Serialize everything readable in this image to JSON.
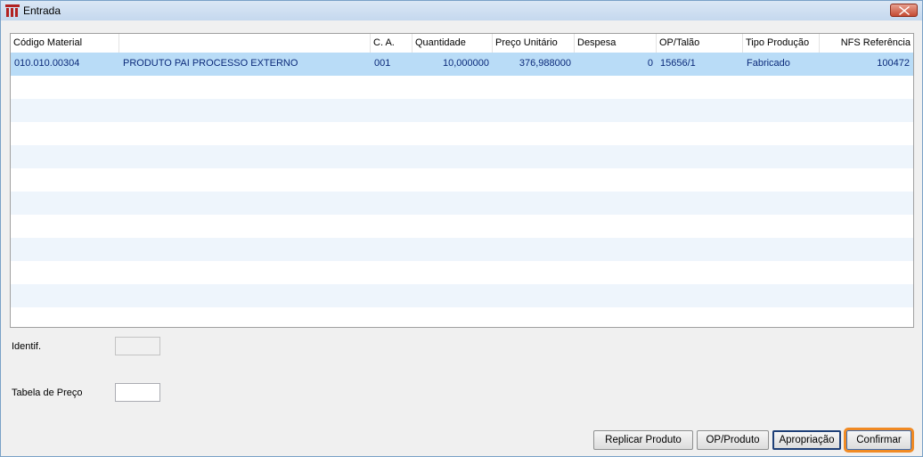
{
  "window": {
    "title": "Entrada"
  },
  "colors": {
    "selected_row": "#b9dcf7",
    "alt_row": "#eef5fc",
    "focus_outline": "#f08a24"
  },
  "grid": {
    "columns": [
      "Código Material",
      "",
      "C. A.",
      "Quantidade",
      "Preço Unitário",
      "Despesa",
      "OP/Talão",
      "Tipo Produção",
      "NFS Referência"
    ],
    "rows": [
      [
        "010.010.00304",
        "PRODUTO PAI PROCESSO EXTERNO",
        "001",
        "10,000000",
        "376,988000",
        "0",
        "15656/1",
        "Fabricado",
        "100472"
      ]
    ]
  },
  "form": {
    "identif_label": "Identif.",
    "identif_value": "",
    "tabela_label": "Tabela de Preço",
    "tabela_value": ""
  },
  "buttons": {
    "replicar": "Replicar Produto",
    "op_produto": "OP/Produto",
    "apropriacao": "Apropriação",
    "confirmar": "Confirmar"
  },
  "icons": {
    "app": "app-logo-icon",
    "close": "close-icon"
  }
}
